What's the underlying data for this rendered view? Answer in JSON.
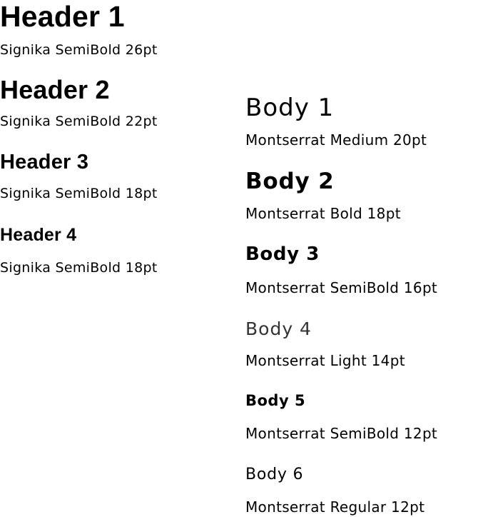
{
  "headers": [
    {
      "title": "Header 1",
      "description": "Signika SemiBold 26pt"
    },
    {
      "title": "Header 2",
      "description": "Signika SemiBold 22pt"
    },
    {
      "title": "Header 3",
      "description": "Signika SemiBold 18pt"
    },
    {
      "title": "Header 4",
      "description": "Signika SemiBold 18pt"
    }
  ],
  "body_styles": [
    {
      "title": "Body 1",
      "description": "Montserrat Medium 20pt"
    },
    {
      "title": "Body 2",
      "description": "Montserrat Bold 18pt"
    },
    {
      "title": "Body 3",
      "description": "Montserrat SemiBold 16pt"
    },
    {
      "title": "Body 4",
      "description": "Montserrat Light 14pt"
    },
    {
      "title": "Body 5",
      "description": "Montserrat SemiBold 12pt"
    },
    {
      "title": "Body 6",
      "description": "Montserrat Regular 12pt"
    }
  ]
}
